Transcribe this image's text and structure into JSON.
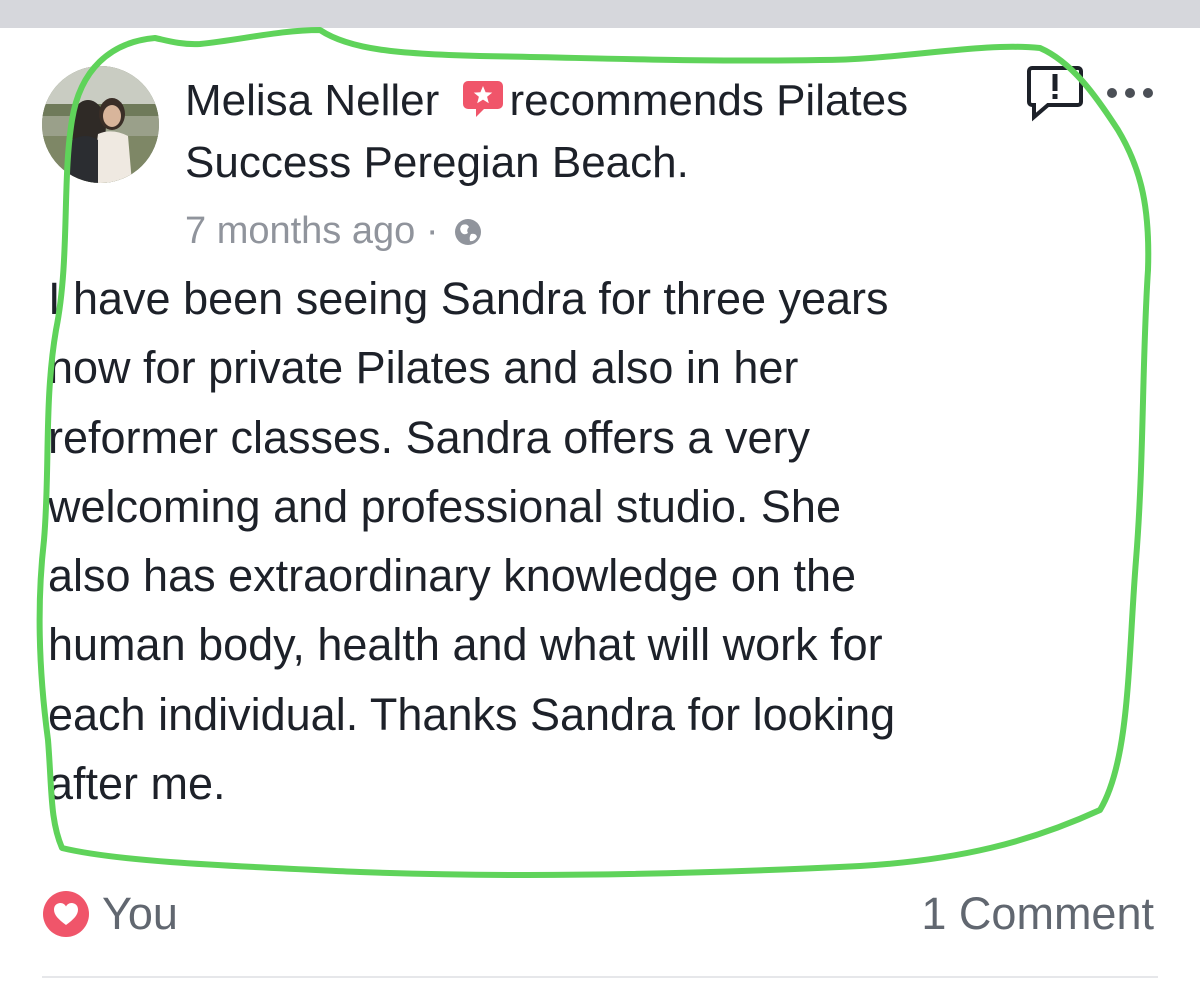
{
  "post": {
    "author": "Melisa Neller",
    "action_text": "recommends Pilates",
    "page_name": "Success Peregian Beach.",
    "timestamp": "7 months ago",
    "separator": "·",
    "body_lines": [
      "I have been seeing Sandra for three years",
      "now for private Pilates and also in her",
      "reformer classes. Sandra offers a very",
      "welcoming and professional studio. She",
      "also has extraordinary knowledge on the",
      "human body, health and what will work for",
      "each individual. Thanks Sandra for looking",
      "after me."
    ],
    "reactions_label": "You",
    "comments_label": "1 Comment"
  },
  "icons": {
    "recommend": "recommend-badge-icon",
    "privacy": "globe-icon",
    "report": "report-icon",
    "more": "more-options-icon",
    "reaction": "love-reaction-icon"
  },
  "colors": {
    "recommend_badge": "#f0556a",
    "love_reaction": "#f0556a",
    "highlight_stroke": "#5fd35a",
    "text_primary": "#1d2129",
    "text_secondary": "#90949c",
    "footer_text": "#616770",
    "top_strip": "#d6d7dc"
  }
}
